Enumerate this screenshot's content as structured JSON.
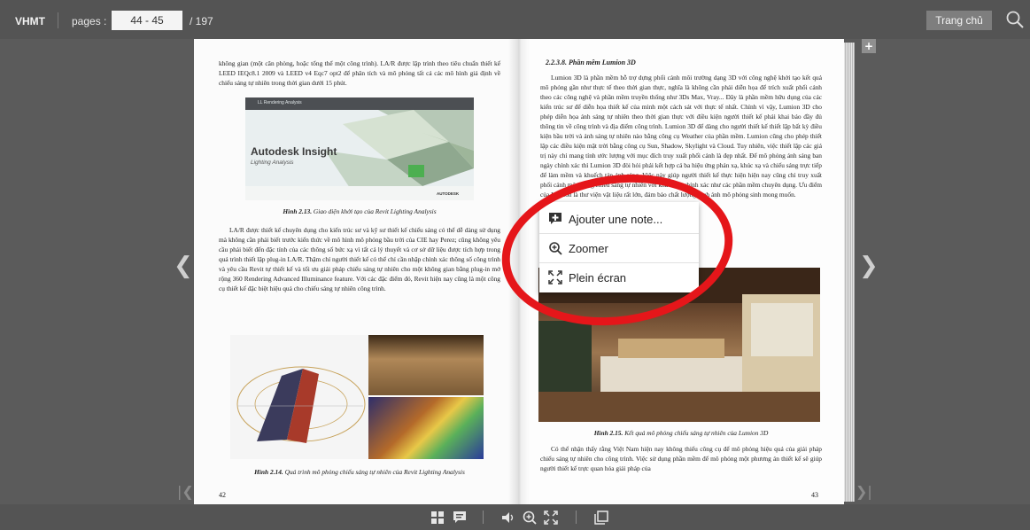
{
  "topbar": {
    "brand": "VHMT",
    "pages_label": "pages :",
    "page_range_value": "44 - 45",
    "page_total": "/ 197",
    "home_button": "Trang chủ"
  },
  "left_page": {
    "intro_text": "không gian (một căn phòng, hoặc tổng thể một công trình). LA/R được lập trình theo tiêu chuẩn thiết kế LEED IEQc8.1 2009 và LEED v4 Eqc7 opt2 để phân tích và mô phỏng tất cả các mô hình giả định về chiếu sáng tự nhiên trong thời gian dưới 15 phút.",
    "figure_213": {
      "video_title": "LL Rendering Analysis",
      "brand_title": "Autodesk Insight",
      "brand_subtitle": "Lighting Analysis",
      "vendor": "AUTODESK",
      "caption_label": "Hình 2.13.",
      "caption_text": "Giao diện khởi tạo của Revit Lighting Analysis"
    },
    "body_text": "LA/R được thiết kế chuyên dụng cho kiến trúc sư và kỹ sư thiết kế chiếu sáng có thể dễ dàng sử dụng mà không cần phải biết trước kiến thức về mô hình mô phỏng bầu trời của CIE hay Perez; cũng không yêu cầu phải biết đến đặc tính của các thông số bức xạ vì tất cả lý thuyết và cơ sở dữ liệu được tích hợp trong quá trình thiết lập plug-in LA/R. Thậm chí người thiết kế có thể chỉ cần nhập chính xác thông số công trình và yêu cầu Revit tự thiết kế và tối ưu giải pháp chiếu sáng tự nhiên cho một không gian bằng plug-in mở rộng 360 Rendering Advanced Illuminance feature. Với các đặc điểm đó, Revit hiện nay cũng là một công cụ thiết kế đặc biệt hiệu quả cho chiếu sáng tự nhiên công trình.",
    "figure_214": {
      "caption_label": "Hình 2.14.",
      "caption_text": "Quá trình mô phỏng chiếu sáng tự nhiên của Revit Lighting Analysis"
    },
    "page_number": "42"
  },
  "right_page": {
    "heading": "2.2.3.8. Phần mềm Lumion 3D",
    "body_text": "Lumion 3D là phần mềm hỗ trợ dựng phối cảnh môi trường dạng 3D với công nghệ khởi tạo kết quả mô phỏng gần như thực tế theo thời gian thực, nghĩa là không cần phải diễn họa để trích xuất phối cảnh theo các công nghệ và phần mềm truyền thống như 3Ds Max, Vray... Đây là phần mềm hữu dụng của các kiến trúc sư để diễn họa thiết kế của mình một cách sát với thực tế nhất. Chính vì vậy, Lumion 3D cho phép diễn họa ánh sáng tự nhiên theo thời gian thực với điều kiện người thiết kế phải khai báo đầy đủ thông tin về công trình và địa điểm công trình. Lumion 3D để dàng cho người thiết kế thiết lập bất kỳ điều kiện bầu trời và ánh sáng tự nhiên nào bằng công cụ Weather của phần mềm. Lumion cũng cho phép thiết lập các điều kiện mặt trời bằng công cụ Sun, Shadow, Skylight và Cloud. Tuy nhiên, việc thiết lập các giá trị này chỉ mang tính ước lượng với mục đích truy xuất phối cảnh là đẹp nhất. Để mô phỏng ánh sáng ban ngày chính xác thì Lumion 3D đòi hỏi phải kết hợp cả ba hiệu ứng phản xạ, khúc xạ và chiếu sáng trực tiếp để làm mềm và khuếch tán ánh sáng. Việc này giúp người thiết kế thực hiện hiện nay cũng chỉ truy xuất phối cảnh mô phỏng chiếu sáng tự nhiên với khả năng chính xác như các phần mềm chuyên dụng. Ưu điểm của Lumion là thư viện vật liệu rất lớn, đảm bảo chất lượng hình ảnh mô phỏng sinh mong muốn.",
    "figure_215": {
      "caption_label": "Hình 2.15.",
      "caption_text": "Kết quả mô phỏng chiếu sáng tự nhiên của Lumion 3D"
    },
    "closing_text": "Có thể nhận thấy rằng Việt Nam hiện nay không thiếu công cụ để mô phỏng hiệu quả của giải pháp chiếu sáng tự nhiên cho công trình. Việc sử dụng phần mềm để mô phỏng một phương án thiết kế sẽ giúp người thiết kế trực quan hóa giải pháp của",
    "page_number": "43"
  },
  "context_menu": {
    "items": [
      {
        "label": "Ajouter une note...",
        "icon": "add-note-icon"
      },
      {
        "label": "Zoomer",
        "icon": "zoom-in-icon"
      },
      {
        "label": "Plein écran",
        "icon": "fullscreen-icon"
      }
    ]
  },
  "navigation": {
    "prev_icon": "chevron-left-icon",
    "next_icon": "chevron-right-icon",
    "first_icon": "first-page-icon",
    "last_icon": "last-page-icon"
  },
  "bottom_toolbar": {
    "icons": [
      "thumbnails-icon",
      "notes-icon",
      "sound-icon",
      "zoom-icon",
      "fullscreen-icon",
      "print-icon"
    ]
  },
  "colors": {
    "background": "#5b5b5b",
    "toolbar": "#545454",
    "annotation_ring": "#e5161a"
  }
}
